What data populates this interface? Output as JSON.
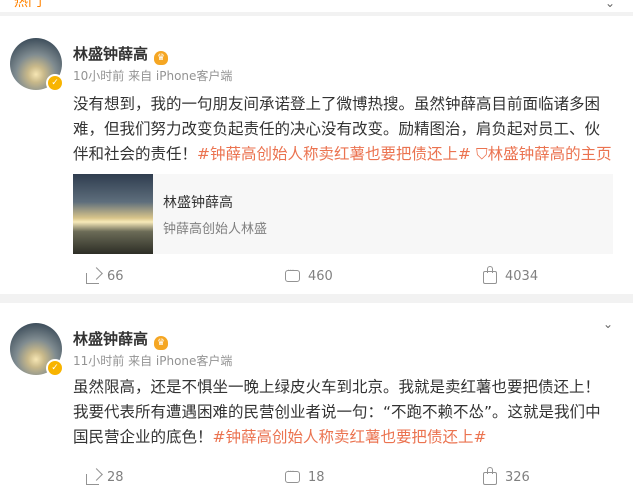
{
  "header": {
    "tab_label": "热门",
    "chevron_icon": "chevron-down-icon"
  },
  "posts": [
    {
      "author": "林盛钟薛高",
      "meta": "10小时前  来自 iPhone客户端",
      "text_parts": [
        "没有想到，我的一句朋友间承诺登上了微博热搜。虽然钟薛高目前面临诸多困难，但我们努力改变负起责任的决心没有改变。励精图治，肩负起对员工、伙伴和社会的责任！",
        "#钟薛高创始人称卖红薯也要把债还上#",
        " ",
        "钟薛高的主页"
      ],
      "mention_prefix": "林盛",
      "share_card": {
        "title": "林盛钟薛高",
        "subtitle": "钟薛高创始人林盛"
      },
      "actions": {
        "forward": "66",
        "comment": "460",
        "like": "4034"
      }
    },
    {
      "author": "林盛钟薛高",
      "meta": "11小时前  来自 iPhone客户端",
      "text_parts": [
        "虽然限高，还是不惧坐一晚上绿皮火车到北京。我就是卖红薯也要把债还上！我要代表所有遭遇困难的民营创业者说一句：“不跑不赖不怂”。这就是我们中国民营企业的底色！",
        "#钟薛高创始人称卖红薯也要把债还上#"
      ],
      "actions": {
        "forward": "28",
        "comment": "18",
        "like": "326"
      }
    }
  ],
  "colors": {
    "accent": "#eb7350",
    "tab_accent": "#ff8200",
    "verified": "#f8b400"
  }
}
